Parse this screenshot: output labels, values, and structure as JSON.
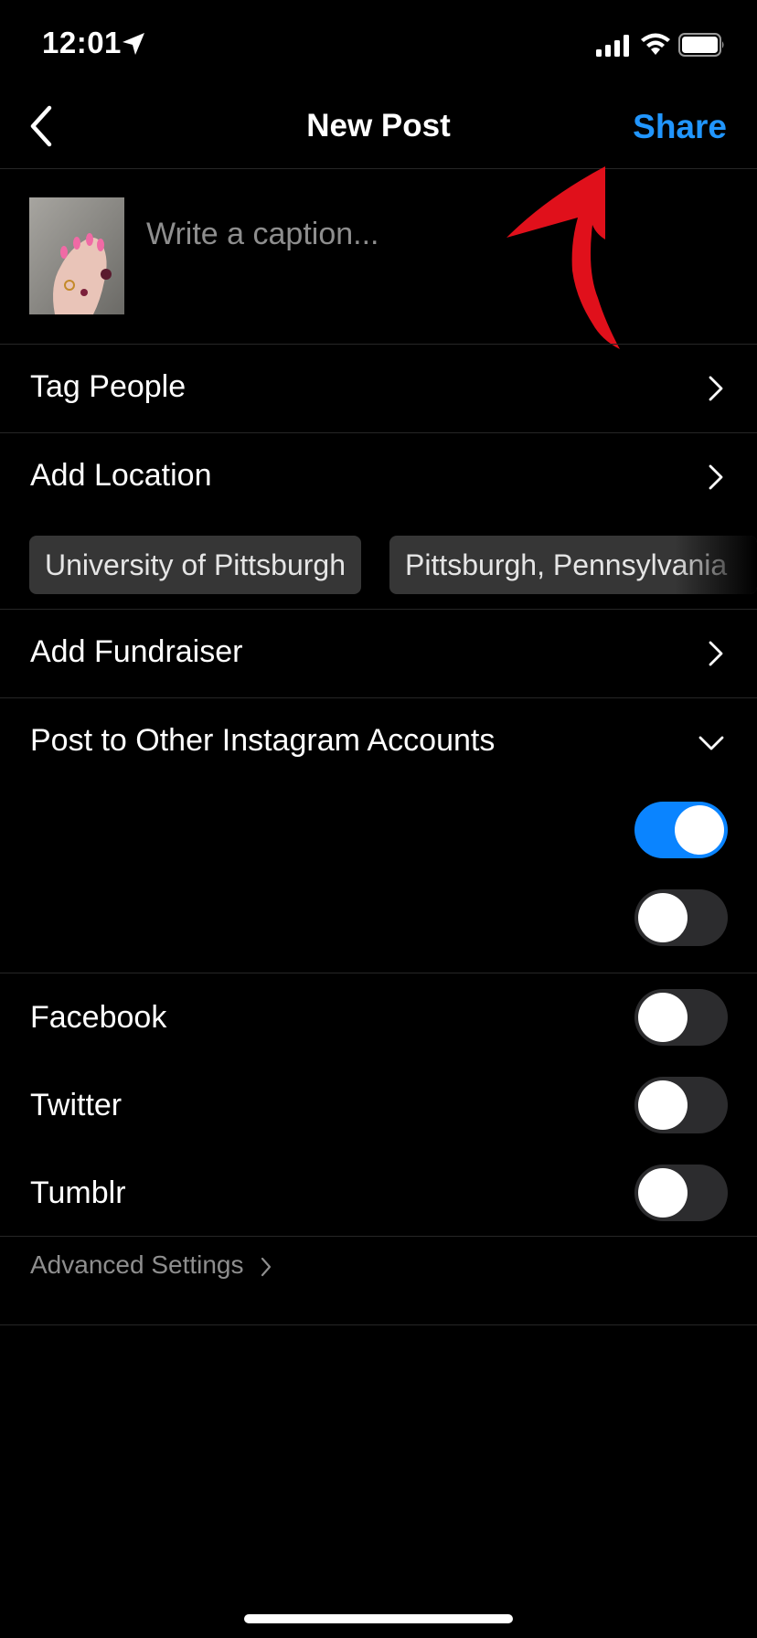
{
  "status_bar": {
    "time": "12:01"
  },
  "header": {
    "title": "New Post",
    "share_label": "Share"
  },
  "caption": {
    "placeholder": "Write a caption..."
  },
  "rows": {
    "tag_people": "Tag People",
    "add_location": "Add Location",
    "add_fundraiser": "Add Fundraiser",
    "post_to_other_accounts": "Post to Other Instagram Accounts"
  },
  "location_suggestions": [
    "University of Pittsburgh",
    "Pittsburgh, Pennsylvania"
  ],
  "other_account_toggles": [
    true,
    false
  ],
  "share_targets": [
    {
      "label": "Facebook",
      "on": false
    },
    {
      "label": "Twitter",
      "on": false
    },
    {
      "label": "Tumblr",
      "on": false
    }
  ],
  "footer": {
    "advanced_settings": "Advanced Settings"
  },
  "colors": {
    "accent": "#2196ff",
    "toggle_on": "#0a84ff",
    "arrow": "#e0101b"
  }
}
